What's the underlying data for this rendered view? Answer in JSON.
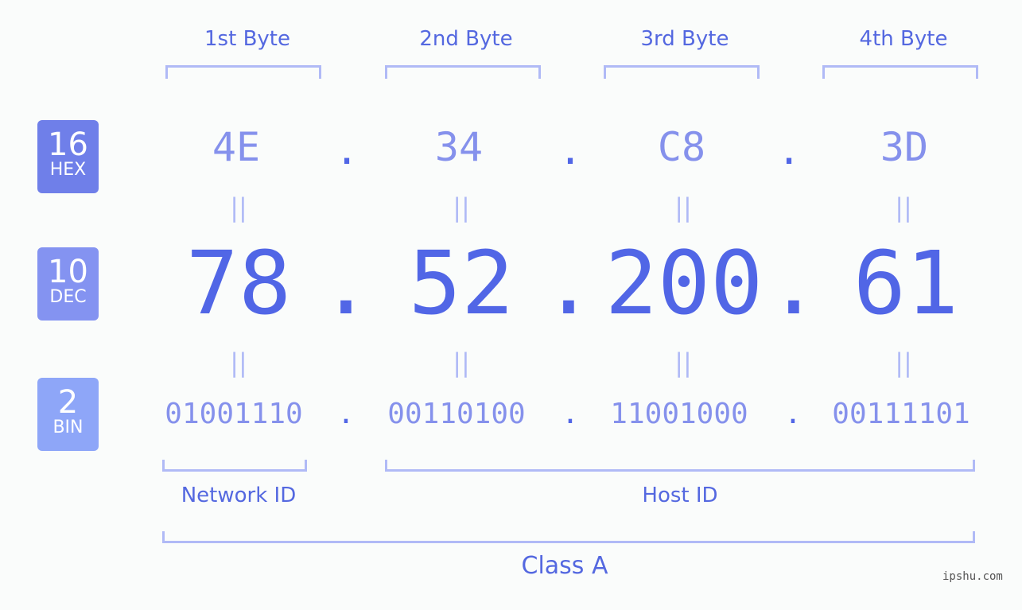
{
  "headers": [
    "1st Byte",
    "2nd Byte",
    "3rd Byte",
    "4th Byte"
  ],
  "badges": [
    {
      "number": "16",
      "label": "HEX",
      "color": "#6f7fe9"
    },
    {
      "number": "10",
      "label": "DEC",
      "color": "#8493f1"
    },
    {
      "number": "2",
      "label": "BIN",
      "color": "#8ea6f8"
    }
  ],
  "hex": [
    "4E",
    "34",
    "C8",
    "3D"
  ],
  "dec": [
    "78",
    "52",
    "200",
    "61"
  ],
  "bin": [
    "01001110",
    "00110100",
    "11001000",
    "00111101"
  ],
  "separator": ".",
  "equals": "||",
  "network_label": "Network ID",
  "host_label": "Host ID",
  "class_label": "Class A",
  "watermark": "ipshu.com"
}
